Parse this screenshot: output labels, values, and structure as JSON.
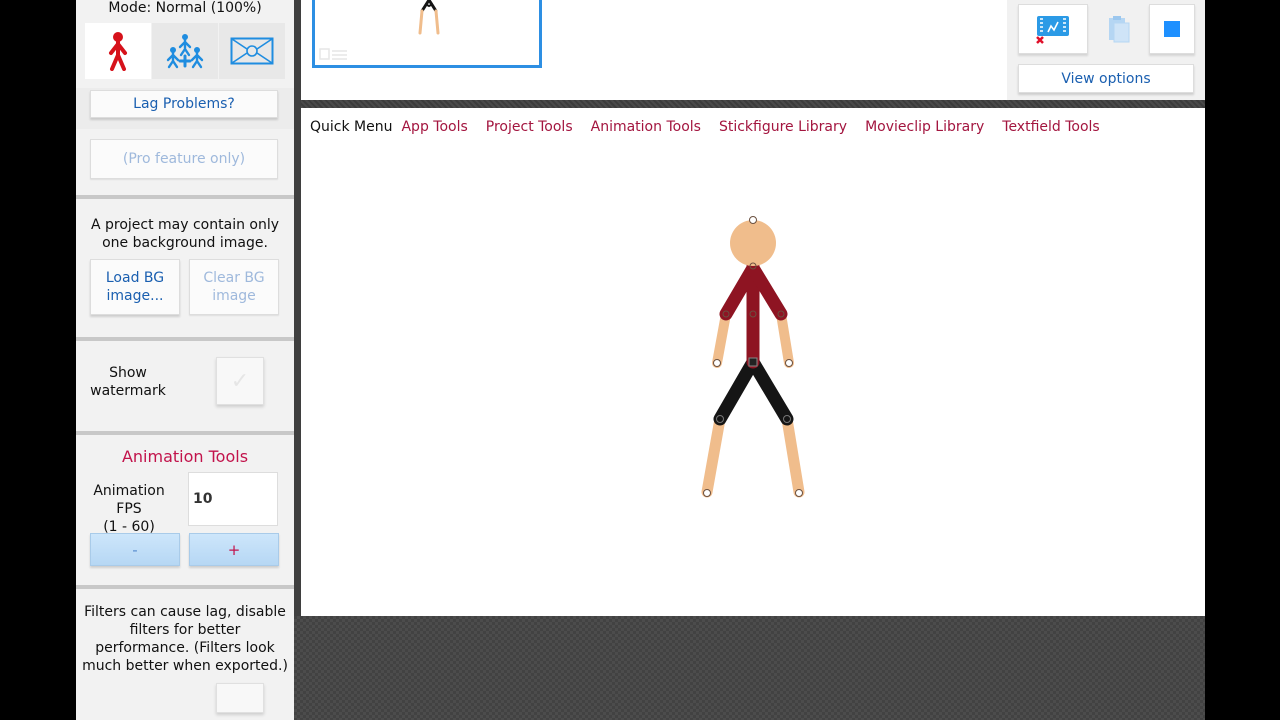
{
  "left_panel": {
    "mode_title": "Mode: Normal (100%)",
    "modes": [
      {
        "icon": "single-stickfigure-icon",
        "active": true
      },
      {
        "icon": "group-stickfigures-icon",
        "active": false
      },
      {
        "icon": "background-scene-icon",
        "active": false
      }
    ],
    "lag_button": "Lag Problems?",
    "pro_feature": "(Pro feature only)",
    "bg_note": "A project may contain only one background image.",
    "load_bg_line1": "Load BG",
    "load_bg_line2": "image...",
    "clear_bg_line1": "Clear BG",
    "clear_bg_line2": "image",
    "watermark_line1": "Show",
    "watermark_line2": "watermark",
    "watermark_checked": false,
    "animation_heading": "Animation Tools",
    "fps_line1": "Animation FPS",
    "fps_line2": "(1 - 60)",
    "fps_value": "10",
    "minus_label": "-",
    "plus_label": "+",
    "filters_note": "Filters can cause lag, disable filters for better performance. (Filters look much better when exported.)"
  },
  "top_right": {
    "view_options": "View options"
  },
  "quick_menu": {
    "label": "Quick Menu",
    "items": [
      "App Tools",
      "Project Tools",
      "Animation Tools",
      "Stickfigure Library",
      "Movieclip Library",
      "Textfield Tools"
    ]
  },
  "colors": {
    "accent_red": "#c2134b",
    "link_blue": "#1a5fb0",
    "skin": "#f0bd8c",
    "torso": "#8e1422",
    "legs": "#151515",
    "frame_border": "#2d8fe3"
  }
}
